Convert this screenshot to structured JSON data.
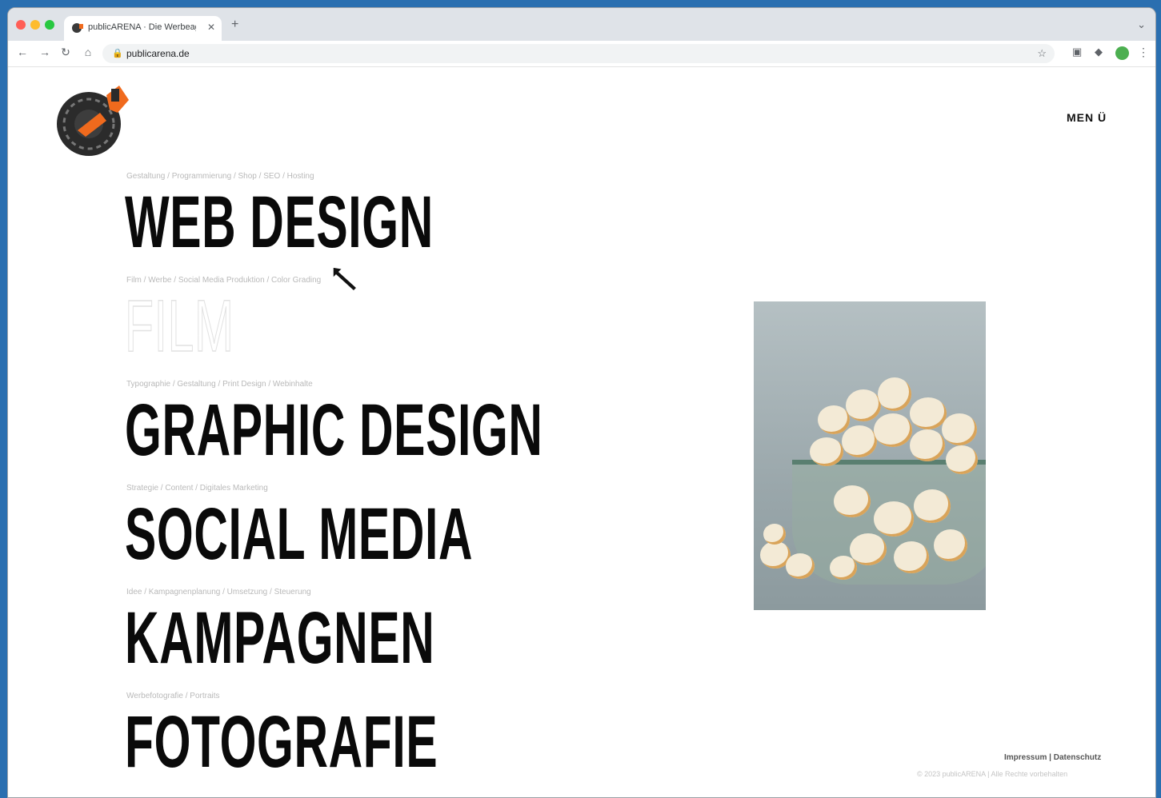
{
  "browser": {
    "tab_title": "publicARENA · Die Werbeagentur",
    "new_tab_glyph": "+",
    "url": "publicarena.de",
    "traffic_lights": [
      "#ff5f57",
      "#febc2e",
      "#28c840"
    ]
  },
  "site": {
    "menu_label": "MEN Ü",
    "services": [
      {
        "sub": "Gestaltung / Programmierung / Shop / SEO / Hosting",
        "title": "WEB DESIGN",
        "style": "filled"
      },
      {
        "sub": "Film / Werbe / Social Media Produktion / Color Grading",
        "title": "FILM",
        "style": "outline"
      },
      {
        "sub": "Typographie / Gestaltung / Print Design / Webinhalte",
        "title": "GRAPHIC DESIGN",
        "style": "filled"
      },
      {
        "sub": "Strategie / Content / Digitales Marketing",
        "title": "SOCIAL MEDIA",
        "style": "filled"
      },
      {
        "sub": "Idee / Kampagnenplanung / Umsetzung / Steuerung",
        "title": "KAMPAGNEN",
        "style": "filled"
      },
      {
        "sub": "Werbefotografie / Portraits",
        "title": "FOTOGRAFIE",
        "style": "filled"
      }
    ],
    "footer": {
      "impressum": "Impressum",
      "separator": "|",
      "datenschutz": "Datenschutz",
      "copyright": "© 2023 publicARENA | Alle Rechte vorbehalten"
    },
    "colors": {
      "accent": "#f06a1d",
      "text": "#0a0a0a"
    }
  }
}
